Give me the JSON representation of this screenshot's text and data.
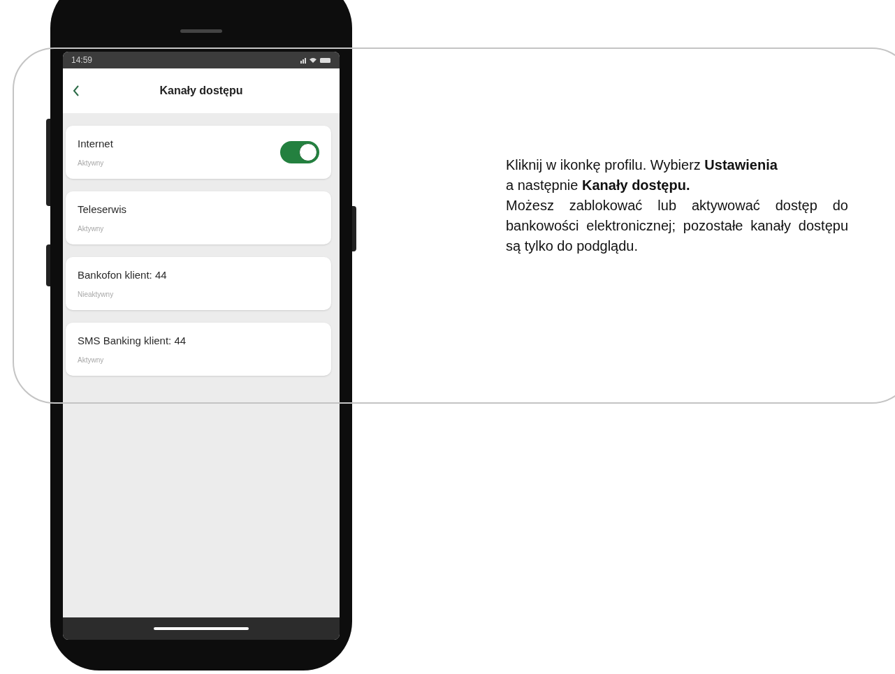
{
  "status_bar": {
    "time": "14:59"
  },
  "header": {
    "title": "Kanały dostępu"
  },
  "channels": [
    {
      "kind": "toggle",
      "name": "Internet",
      "status": "Aktywny",
      "on": true
    },
    {
      "kind": "plain",
      "name": "Teleserwis",
      "status": "Aktywny"
    },
    {
      "kind": "plain",
      "name": "Bankofon klient: 44",
      "status": "Nieaktywny"
    },
    {
      "kind": "plain",
      "name": "SMS Banking klient: 44",
      "status": "Aktywny"
    }
  ],
  "instructions": [
    "Kliknij w ikonkę profilu. Wybierz **Ustawienia**",
    "a następnie **Kanały dostępu.**",
    "Możesz zablokować lub aktywować dostęp do bankowości elektronicznej; pozostałe kanały dostępu są tylko do podglądu."
  ]
}
